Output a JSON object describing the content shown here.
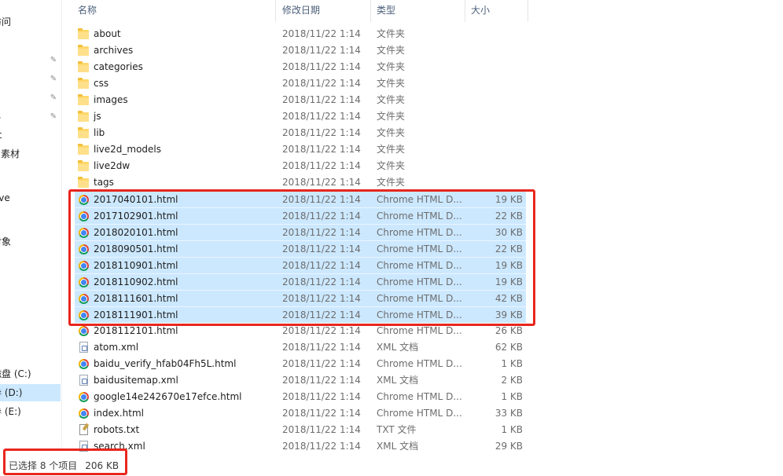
{
  "nav": {
    "items": [
      {
        "label": "访问",
        "pinned": false,
        "selected": false
      },
      {
        "label": "",
        "pinned": true,
        "selected": false
      },
      {
        "label": "",
        "pinned": true,
        "selected": false
      },
      {
        "label": "",
        "pinned": true,
        "selected": false
      },
      {
        "label": "",
        "pinned": true,
        "selected": false
      },
      {
        "label": "ts",
        "pinned": false,
        "selected": false
      },
      {
        "label": "ut",
        "pinned": false,
        "selected": false
      },
      {
        "label": "pi素材",
        "pinned": false,
        "selected": false
      },
      {
        "label": "rive",
        "pinned": false,
        "selected": false
      },
      {
        "label": "i",
        "pinned": false,
        "selected": false
      },
      {
        "label": "对象",
        "pinned": false,
        "selected": false
      },
      {
        "label": "磁盘 (C:)",
        "pinned": false,
        "selected": false
      },
      {
        "label": "卷 (D:)",
        "pinned": false,
        "selected": true
      },
      {
        "label": "卷 (E:)",
        "pinned": false,
        "selected": false
      }
    ]
  },
  "columns": {
    "name": "名称",
    "date": "修改日期",
    "type": "类型",
    "size": "大小"
  },
  "files": [
    {
      "name": "about",
      "date": "2018/11/22 1:14",
      "type": "文件夹",
      "size": "",
      "icon": "folder-icon",
      "selected": false
    },
    {
      "name": "archives",
      "date": "2018/11/22 1:14",
      "type": "文件夹",
      "size": "",
      "icon": "folder-icon",
      "selected": false
    },
    {
      "name": "categories",
      "date": "2018/11/22 1:14",
      "type": "文件夹",
      "size": "",
      "icon": "folder-icon",
      "selected": false
    },
    {
      "name": "css",
      "date": "2018/11/22 1:14",
      "type": "文件夹",
      "size": "",
      "icon": "folder-icon",
      "selected": false
    },
    {
      "name": "images",
      "date": "2018/11/22 1:14",
      "type": "文件夹",
      "size": "",
      "icon": "folder-icon",
      "selected": false
    },
    {
      "name": "js",
      "date": "2018/11/22 1:14",
      "type": "文件夹",
      "size": "",
      "icon": "folder-icon",
      "selected": false
    },
    {
      "name": "lib",
      "date": "2018/11/22 1:14",
      "type": "文件夹",
      "size": "",
      "icon": "folder-icon",
      "selected": false
    },
    {
      "name": "live2d_models",
      "date": "2018/11/22 1:14",
      "type": "文件夹",
      "size": "",
      "icon": "folder-icon",
      "selected": false
    },
    {
      "name": "live2dw",
      "date": "2018/11/22 1:14",
      "type": "文件夹",
      "size": "",
      "icon": "folder-icon",
      "selected": false
    },
    {
      "name": "tags",
      "date": "2018/11/22 1:14",
      "type": "文件夹",
      "size": "",
      "icon": "folder-icon",
      "selected": false
    },
    {
      "name": "2017040101.html",
      "date": "2018/11/22 1:14",
      "type": "Chrome HTML D...",
      "size": "19 KB",
      "icon": "chrome-icon",
      "selected": true
    },
    {
      "name": "2017102901.html",
      "date": "2018/11/22 1:14",
      "type": "Chrome HTML D...",
      "size": "22 KB",
      "icon": "chrome-icon",
      "selected": true
    },
    {
      "name": "2018020101.html",
      "date": "2018/11/22 1:14",
      "type": "Chrome HTML D...",
      "size": "30 KB",
      "icon": "chrome-icon",
      "selected": true
    },
    {
      "name": "2018090501.html",
      "date": "2018/11/22 1:14",
      "type": "Chrome HTML D...",
      "size": "22 KB",
      "icon": "chrome-icon",
      "selected": true
    },
    {
      "name": "2018110901.html",
      "date": "2018/11/22 1:14",
      "type": "Chrome HTML D...",
      "size": "19 KB",
      "icon": "chrome-icon",
      "selected": true
    },
    {
      "name": "2018110902.html",
      "date": "2018/11/22 1:14",
      "type": "Chrome HTML D...",
      "size": "19 KB",
      "icon": "chrome-icon",
      "selected": true
    },
    {
      "name": "2018111601.html",
      "date": "2018/11/22 1:14",
      "type": "Chrome HTML D...",
      "size": "42 KB",
      "icon": "chrome-icon",
      "selected": true
    },
    {
      "name": "2018111901.html",
      "date": "2018/11/22 1:14",
      "type": "Chrome HTML D...",
      "size": "39 KB",
      "icon": "chrome-icon",
      "selected": true
    },
    {
      "name": "2018112101.html",
      "date": "2018/11/22 1:14",
      "type": "Chrome HTML D...",
      "size": "26 KB",
      "icon": "chrome-icon",
      "selected": false
    },
    {
      "name": "atom.xml",
      "date": "2018/11/22 1:14",
      "type": "XML 文档",
      "size": "62 KB",
      "icon": "xml-file-icon",
      "selected": false
    },
    {
      "name": "baidu_verify_hfab04Fh5L.html",
      "date": "2018/11/22 1:14",
      "type": "Chrome HTML D...",
      "size": "1 KB",
      "icon": "chrome-icon",
      "selected": false
    },
    {
      "name": "baidusitemap.xml",
      "date": "2018/11/22 1:14",
      "type": "XML 文档",
      "size": "2 KB",
      "icon": "xml-file-icon",
      "selected": false
    },
    {
      "name": "google14e242670e17efce.html",
      "date": "2018/11/22 1:14",
      "type": "Chrome HTML D...",
      "size": "1 KB",
      "icon": "chrome-icon",
      "selected": false
    },
    {
      "name": "index.html",
      "date": "2018/11/22 1:14",
      "type": "Chrome HTML D...",
      "size": "33 KB",
      "icon": "chrome-icon",
      "selected": false
    },
    {
      "name": "robots.txt",
      "date": "2018/11/22 1:14",
      "type": "TXT 文件",
      "size": "1 KB",
      "icon": "txt-file-icon",
      "selected": false
    },
    {
      "name": "search.xml",
      "date": "2018/11/22 1:14",
      "type": "XML 文档",
      "size": "29 KB",
      "icon": "xml-file-icon",
      "selected": false
    }
  ],
  "status": {
    "selection": "已选择 8 个项目",
    "size": "206 KB"
  },
  "colors": {
    "selection": "#cce8ff",
    "highlight": "#e8261d",
    "header_text": "#4c607a"
  }
}
